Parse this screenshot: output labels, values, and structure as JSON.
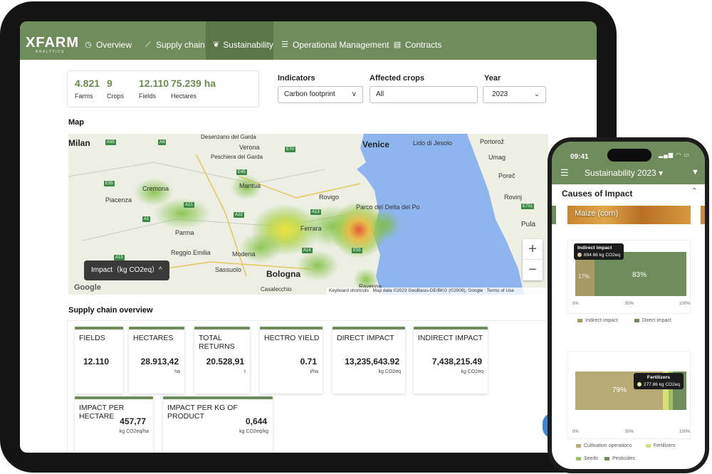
{
  "app": {
    "logo": "XFARM",
    "logo_sub": "ANALYTICS",
    "nav": [
      {
        "label": "Overview",
        "icon": "clock-icon"
      },
      {
        "label": "Supply chain",
        "icon": "chart-line-icon"
      },
      {
        "label": "Sustainability",
        "icon": "leaf-icon",
        "active": true
      },
      {
        "label": "Operational Management",
        "icon": "list-icon"
      },
      {
        "label": "Contracts",
        "icon": "document-icon"
      }
    ]
  },
  "summary": [
    {
      "value": "4.821",
      "label": "Farms"
    },
    {
      "value": "9",
      "label": "Crops"
    },
    {
      "value": "12.110",
      "label": "Fields"
    },
    {
      "value": "75.239 ha",
      "label": "Hectares"
    }
  ],
  "filters": {
    "indicators": {
      "label": "Indicators",
      "value": "Carbon footprint"
    },
    "affected_crops": {
      "label": "Affected crops",
      "value": "All"
    },
    "year": {
      "label": "Year",
      "value": "2023"
    }
  },
  "map": {
    "section_title": "Map",
    "legend_button": "Impact（kg CO2eq）^",
    "places": [
      {
        "name": "Milan"
      },
      {
        "name": "Desenzano del Garda"
      },
      {
        "name": "Verona"
      },
      {
        "name": "Peschiera del Garda"
      },
      {
        "name": "Venice"
      },
      {
        "name": "Lido di Jesolo"
      },
      {
        "name": "Cremona"
      },
      {
        "name": "Mantua"
      },
      {
        "name": "Piacenza"
      },
      {
        "name": "Rovigo"
      },
      {
        "name": "Parco del Delta del Po"
      },
      {
        "name": "Ferrara"
      },
      {
        "name": "Parma"
      },
      {
        "name": "Reggio Emilia"
      },
      {
        "name": "Modena"
      },
      {
        "name": "Sassuolo"
      },
      {
        "name": "Bologna"
      },
      {
        "name": "Casalecchio"
      },
      {
        "name": "Ravenna"
      },
      {
        "name": "Pula"
      },
      {
        "name": "Umag"
      },
      {
        "name": "Poreč"
      },
      {
        "name": "Rovinj"
      },
      {
        "name": "Portorož"
      }
    ],
    "roads": [
      "A35",
      "A4",
      "E70",
      "E45",
      "A22",
      "A1",
      "E35",
      "A21",
      "A13",
      "A14",
      "E55",
      "E751",
      "A15"
    ],
    "attribution_shortcuts": "Keyboard shortcuts",
    "attribution_data": "Map data ©2023 GeoBasis-DE/BKG (©2009), Google",
    "attribution_terms": "Terms of Use",
    "google": "Google",
    "zoom_in": "+",
    "zoom_out": "−"
  },
  "overview": {
    "section_title": "Supply chain overview",
    "cards": [
      {
        "title": "FIELDS",
        "value": "12.110",
        "unit": ""
      },
      {
        "title": "HECTARES",
        "value": "28.913,42",
        "unit": "ha"
      },
      {
        "title": "TOTAL RETURNS",
        "value": "20.528,91",
        "unit": "t"
      },
      {
        "title": "HECTRO YIELD",
        "value": "0.71",
        "unit": "t/ha"
      },
      {
        "title": "DIRECT IMPACT",
        "value": "13,235,643.92",
        "unit": "kg CO2eq"
      },
      {
        "title": "INDIRECT IMPACT",
        "value": "7,438,215.49",
        "unit": "kg CO2eq"
      },
      {
        "title": "IMPACT PER HECTARE",
        "value": "457,77",
        "unit": "kg CO2eq/ha"
      },
      {
        "title": "IMPACT PER KG OF PRODUCT",
        "value": "0,644",
        "unit": "kg CO2eq/kg"
      }
    ]
  },
  "phone": {
    "time": "09:41",
    "status": "▂▄▆ ◠ ▭",
    "title": "Sustainability 2023 ▾",
    "section": "Causes of Impact",
    "crop": "Maize (corn)",
    "chart1": {
      "tooltip_title": "Indirect impact",
      "tooltip_value": "894.66 kg CO2eq",
      "label_left": "17%",
      "label_right": "83%",
      "indirect_pct": 17,
      "direct_pct": 83,
      "ticks": [
        "0%",
        "50%",
        "100%"
      ],
      "legend": [
        {
          "name": "Indirect impact",
          "color": "#a89a63"
        },
        {
          "name": "Direct impact",
          "color": "#6f8c5c"
        }
      ]
    },
    "chart2": {
      "tooltip_title": "Fertilizers",
      "tooltip_value": "277.86 kg CO2eq",
      "label_main": "79%",
      "cultivation_pct": 79,
      "fertilizers_pct": 5,
      "seeds_pct": 4,
      "pesticides_pct": 12,
      "ticks": [
        "0%",
        "50%",
        "100%"
      ],
      "legend": [
        {
          "name": "Cultivation operations",
          "color": "#b8aa74"
        },
        {
          "name": "Fertilizers",
          "color": "#d8df74"
        },
        {
          "name": "Seeds",
          "color": "#9fbf63"
        },
        {
          "name": "Pesticides",
          "color": "#6f8c5c"
        }
      ]
    }
  },
  "colors": {
    "brand": "#6f8c5c",
    "brand_dark": "#5b7649",
    "accent_value": "#6a8c4c",
    "sea": "#8fb5ee"
  }
}
